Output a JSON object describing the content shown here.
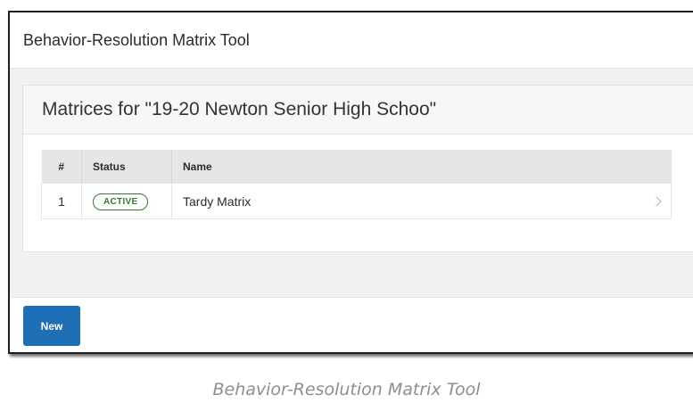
{
  "app": {
    "title": "Behavior-Resolution Matrix Tool"
  },
  "card": {
    "title": "Matrices for \"19-20 Newton Senior High Schoo\""
  },
  "table": {
    "headers": {
      "num": "#",
      "status": "Status",
      "name": "Name"
    },
    "rows": [
      {
        "num": "1",
        "status": "ACTIVE",
        "name": "Tardy Matrix",
        "status_color": "#2f7d32"
      }
    ]
  },
  "footer": {
    "new_label": "New"
  },
  "caption": "Behavior-Resolution Matrix Tool",
  "colors": {
    "primary": "#1f6fb6",
    "active": "#2f7d32"
  },
  "icons": {
    "row_action": "chevron-right-icon"
  }
}
